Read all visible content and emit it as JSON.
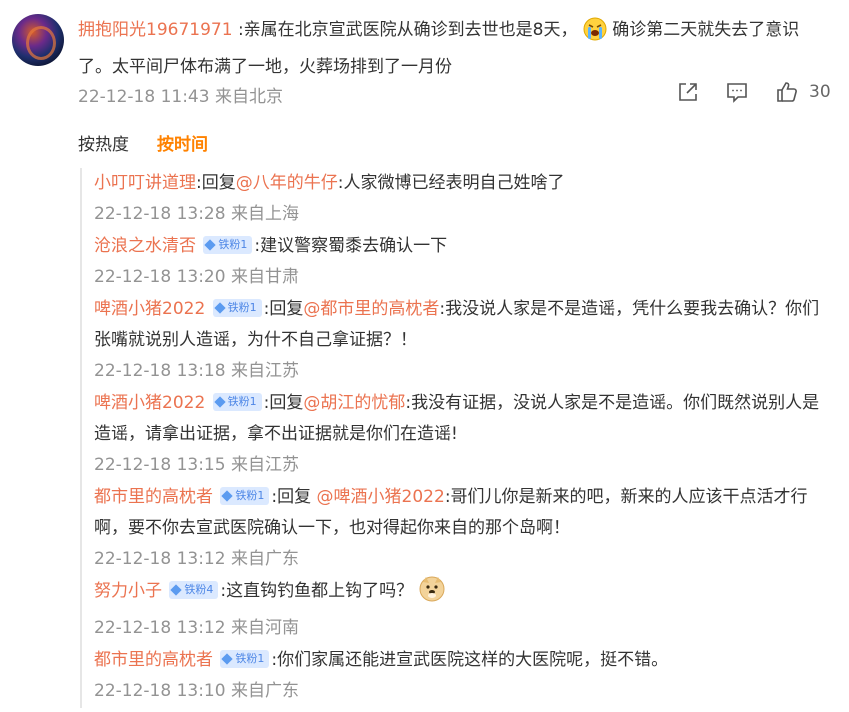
{
  "main": {
    "username": "拥抱阳光19671971",
    "text_a": ":亲属在北京宣武医院从确诊到去世也是8天，",
    "emoji_a": "crying-face-emoji",
    "text_b": "确诊第二天就失去了意识了。太平间尸体布满了一地，火葬场排到了一月份",
    "meta": "22-12-18 11:43 来自北京",
    "like_count": "30"
  },
  "tabs": {
    "hot": "按热度",
    "time": "按时间"
  },
  "colors": {
    "username": "#eb7350",
    "meta": "#939393",
    "active_tab": "#ff8200",
    "badge_bg": "#dbe9ff",
    "badge_text": "#4d86e6"
  },
  "replies": [
    {
      "user": "小叮叮讲道理",
      "badge": "",
      "prefix": ":回复",
      "mention": "@八年的牛仔",
      "text": ":人家微博已经表明自己姓啥了",
      "meta": "22-12-18 13:28 来自上海"
    },
    {
      "user": "沧浪之水清否",
      "badge": "铁粉1",
      "prefix": "",
      "mention": "",
      "text": ":建议警察蜀黍去确认一下",
      "meta": "22-12-18 13:20 来自甘肃"
    },
    {
      "user": "啤酒小猪2022",
      "badge": "铁粉1",
      "prefix": ":回复",
      "mention": "@都市里的高枕者",
      "text": ":我没说人家是不是造谣，凭什么要我去确认？你们张嘴就说别人造谣，为什不自己拿证据？！",
      "meta": "22-12-18 13:18 来自江苏"
    },
    {
      "user": "啤酒小猪2022",
      "badge": "铁粉1",
      "prefix": ":回复",
      "mention": "@胡江的忧郁",
      "text": ":我没有证据，没说人家是不是造谣。你们既然说别人是造谣，请拿出证据，拿不出证据就是你们在造谣!",
      "meta": "22-12-18 13:15 来自江苏"
    },
    {
      "user": "都市里的高枕者",
      "badge": "铁粉1",
      "prefix": ":回复 ",
      "mention": "@啤酒小猪2022",
      "text": ":哥们儿你是新来的吧，新来的人应该干点活才行啊，要不你去宣武医院确认一下，也对得起你来自的那个岛啊！",
      "meta": "22-12-18 13:12 来自广东"
    },
    {
      "user": "努力小子",
      "badge": "铁粉4",
      "prefix": "",
      "mention": "",
      "text": ":这直钩钓鱼都上钩了吗？",
      "emoji": "doge-emoji",
      "meta": "22-12-18 13:12 来自河南"
    },
    {
      "user": "都市里的高枕者",
      "badge": "铁粉1",
      "prefix": "",
      "mention": "",
      "text": ":你们家属还能进宣武医院这样的大医院呢，挺不错。",
      "meta": "22-12-18 13:10 来自广东"
    }
  ]
}
